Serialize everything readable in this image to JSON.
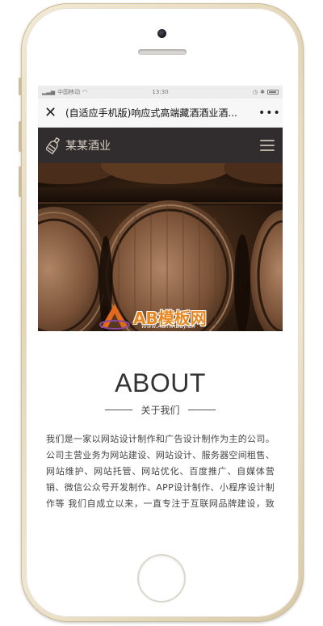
{
  "status_bar": {
    "carrier": "中国移动",
    "time": "13:30"
  },
  "browser": {
    "page_title": "(自适应手机版)响应式高端藏酒酒业酒..."
  },
  "site": {
    "logo_name": "某某酒业"
  },
  "watermark": {
    "brand": "AB模板网",
    "url": "Www.AdminBuy.Cn"
  },
  "about": {
    "title": "ABOUT",
    "subtitle": "关于我们",
    "body": "我们是一家以网站设计制作和广告设计制作为主的公司。公司主营业务为网站建设、网站设计、服务器空间租售、网站维护、网站托管、网站优化、百度推广、自媒体营销、微信公众号开发制作、APP设计制作、小程序设计制作等 我们自成立以来，一直专注于互联网品牌建设，致力于为企业提供专业的网站建设及网络营销服务。"
  },
  "colors": {
    "header_bg": "#312d2f",
    "logo_text": "#d9cfc2",
    "phone_frame": "#e3d6b8"
  }
}
